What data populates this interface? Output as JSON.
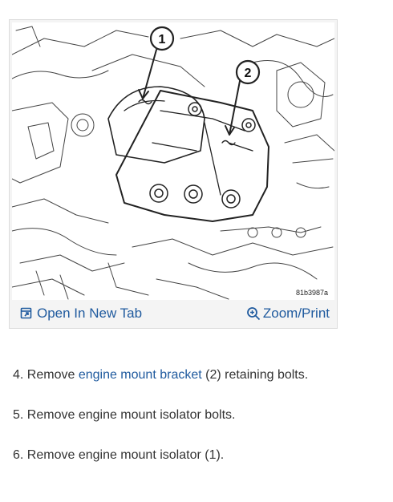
{
  "figure": {
    "image_id": "81b3987a",
    "callouts": [
      "1",
      "2"
    ],
    "open_label": "Open In New Tab",
    "open_icon": "open-new-tab-icon",
    "zoom_label": "Zoom/Print",
    "zoom_icon": "zoom-icon",
    "link_color": "#1f5a9e"
  },
  "steps": [
    {
      "prefix": "4. Remove ",
      "link": "engine mount bracket",
      "suffix": " (2) retaining bolts."
    },
    {
      "text": "5. Remove engine mount isolator bolts."
    },
    {
      "text": "6. Remove engine mount isolator (1)."
    }
  ]
}
